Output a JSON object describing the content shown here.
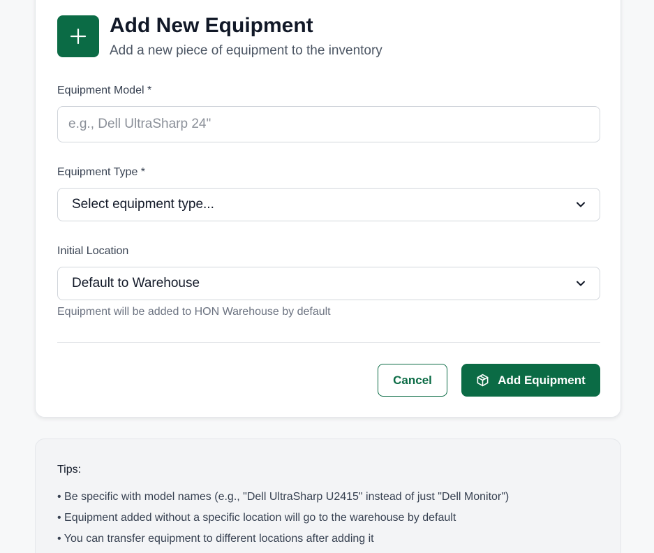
{
  "form": {
    "title": "Add New Equipment",
    "subtitle": "Add a new piece of equipment to the inventory",
    "header_icon": "plus-icon",
    "model": {
      "label": "Equipment Model *",
      "placeholder": "e.g., Dell UltraSharp 24\"",
      "value": ""
    },
    "type": {
      "label": "Equipment Type *",
      "selected": "Select equipment type..."
    },
    "location": {
      "label": "Initial Location",
      "selected": "Default to Warehouse",
      "hint": "Equipment will be added to HON Warehouse by default"
    },
    "cancel_label": "Cancel",
    "submit_label": "Add Equipment",
    "submit_icon": "box-icon"
  },
  "tips": {
    "title": "Tips:",
    "items": [
      "Be specific with model names (e.g., \"Dell UltraSharp U2415\" instead of just \"Dell Monitor\")",
      "Equipment added without a specific location will go to the warehouse by default",
      "You can transfer equipment to different locations after adding it"
    ]
  },
  "colors": {
    "accent": "#0b6b45",
    "background": "#f7f8f9",
    "card": "#ffffff",
    "border": "#d1d5db"
  }
}
